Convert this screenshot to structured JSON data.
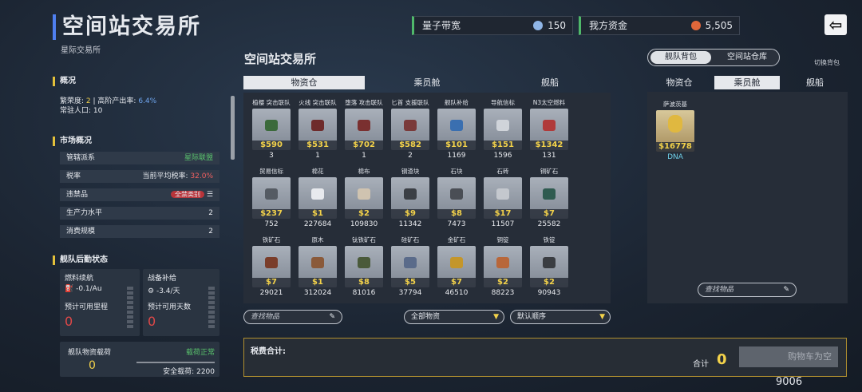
{
  "header": {
    "title": "空间站交易所",
    "subtitle": "星际交易所"
  },
  "hud": {
    "bandwidth_label": "量子带宽",
    "bandwidth_value": "150",
    "funds_label": "我方资金",
    "funds_value": "5,505"
  },
  "overview": {
    "title": "概况",
    "prosperity_label": "繁荣度:",
    "prosperity_value": "2",
    "output_label": "高阶产出率:",
    "output_value": "6.4%",
    "population_label": "常驻人口:",
    "population_value": "10"
  },
  "market": {
    "title": "市场概况",
    "rows": [
      {
        "label": "管辖派系",
        "value": "星际联盟"
      },
      {
        "label": "税率",
        "value_label": "当前平均税率:",
        "value": "32.0%"
      },
      {
        "label": "违禁品",
        "value": "全禁类别"
      },
      {
        "label": "生产力水平",
        "value": "2"
      },
      {
        "label": "消费规模",
        "value": "2"
      }
    ]
  },
  "fleet": {
    "title": "舰队后勤状态",
    "fuel_label": "燃料续航",
    "fuel_rate": "-0.1/Au",
    "fuel_est_label": "预计可用里程",
    "fuel_est": "0",
    "supply_label": "战备补给",
    "supply_rate": "-3.4/天",
    "supply_est_label": "预计可用天数",
    "supply_est": "0",
    "cargo_label": "舰队物资载荷",
    "cargo_status": "载荷正常",
    "cargo_value": "0",
    "safe_label": "安全载荷:",
    "safe_value": "2200"
  },
  "exchange": {
    "title": "空间站交易所",
    "tabs": [
      "物资仓",
      "乘员舱",
      "舰船"
    ],
    "active_tab": 0,
    "search_placeholder": "查找物品",
    "filter": "全部物资",
    "sort": "默认顺序"
  },
  "items": [
    {
      "name": "植樱 突击联队",
      "price": "$590",
      "qty": "3",
      "color": "#3b6a3b"
    },
    {
      "name": "火线 突击联队",
      "price": "$531",
      "qty": "1",
      "color": "#6e2b2b"
    },
    {
      "name": "堕落 攻击联队",
      "price": "$702",
      "qty": "1",
      "color": "#7a3030"
    },
    {
      "name": "匕首 支援联队",
      "price": "$582",
      "qty": "2",
      "color": "#7a3a3a"
    },
    {
      "name": "舰队补给",
      "price": "$101",
      "qty": "1169",
      "color": "#3a6fb0"
    },
    {
      "name": "导航信标",
      "price": "$151",
      "qty": "1596",
      "color": "#d0d4da"
    },
    {
      "name": "N3太空燃料",
      "price": "$1342",
      "qty": "131",
      "color": "#b03a3a"
    },
    {
      "name": "贸易信标",
      "price": "$237",
      "qty": "752",
      "color": "#555b63"
    },
    {
      "name": "棉花",
      "price": "$1",
      "qty": "227684",
      "color": "#e8eaee"
    },
    {
      "name": "棉布",
      "price": "$2",
      "qty": "109830",
      "color": "#cfc3b0"
    },
    {
      "name": "钢渣块",
      "price": "$9",
      "qty": "11342",
      "color": "#3b3f45"
    },
    {
      "name": "石块",
      "price": "$8",
      "qty": "7473",
      "color": "#4a4e55"
    },
    {
      "name": "石砖",
      "price": "$17",
      "qty": "11507",
      "color": "#c4c8ce"
    },
    {
      "name": "铜矿石",
      "price": "$7",
      "qty": "25582",
      "color": "#2f5b50"
    },
    {
      "name": "铁矿石",
      "price": "$7",
      "qty": "29021",
      "color": "#7a3d2a"
    },
    {
      "name": "原木",
      "price": "$1",
      "qty": "312024",
      "color": "#8a5a3a"
    },
    {
      "name": "钛铁矿石",
      "price": "$8",
      "qty": "81016",
      "color": "#4a5a3a"
    },
    {
      "name": "硅矿石",
      "price": "$5",
      "qty": "37794",
      "color": "#5a6b8a"
    },
    {
      "name": "金矿石",
      "price": "$7",
      "qty": "46510",
      "color": "#c4962a"
    },
    {
      "name": "铜锭",
      "price": "$2",
      "qty": "88223",
      "color": "#b8673a"
    },
    {
      "name": "铁锭",
      "price": "$2",
      "qty": "90943",
      "color": "#3a3d42"
    }
  ],
  "inventory": {
    "toggle": [
      "舰队背包",
      "空间站仓库"
    ],
    "switch_label": "切换背包",
    "tabs": [
      "物资仓",
      "乘员舱",
      "舰船"
    ],
    "active_tab": 1,
    "crew": [
      {
        "name": "萨波茨基",
        "price": "$16778",
        "tag": "DNA"
      }
    ],
    "search_placeholder": "查找物品"
  },
  "footer": {
    "tax_label": "税费合计:",
    "total_label": "合计",
    "total_value": "0",
    "cart_button": "购物车为空",
    "build": "9006"
  }
}
